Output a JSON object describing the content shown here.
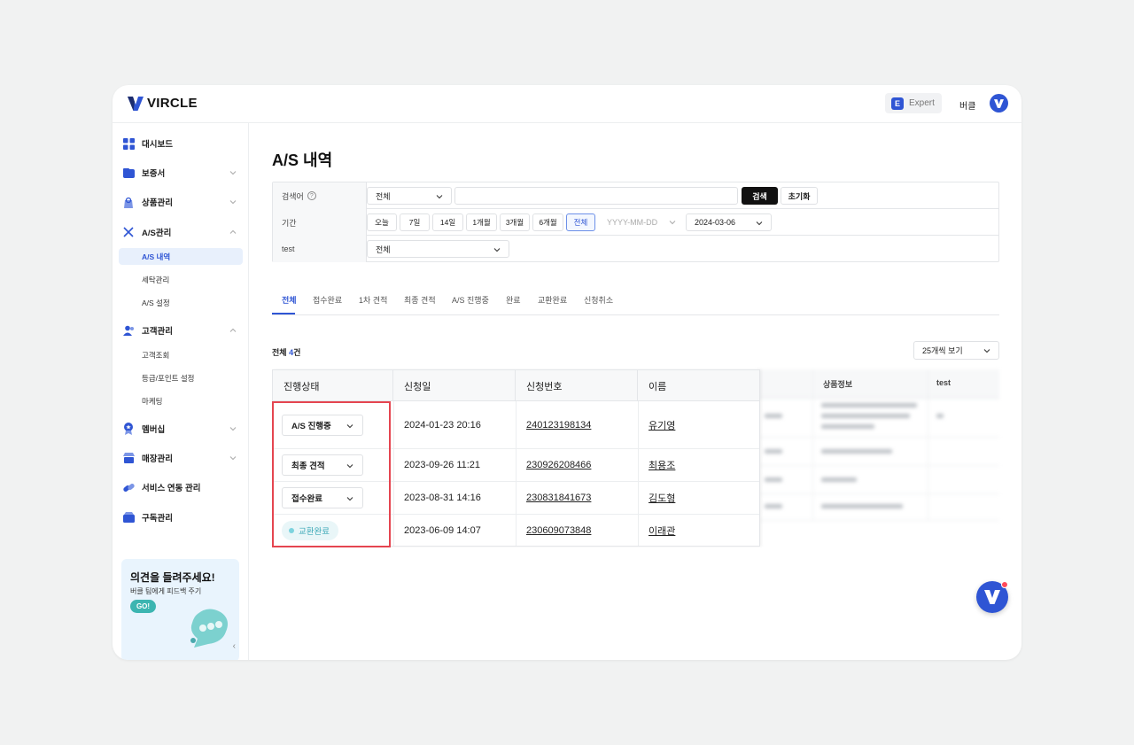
{
  "app": {
    "logo_text": "VIRCLE",
    "plan_letter": "E",
    "plan_label": "Expert",
    "user_name": "버클"
  },
  "sidebar": {
    "items": [
      {
        "label": "대시보드"
      },
      {
        "label": "보증서"
      },
      {
        "label": "상품관리"
      },
      {
        "label": "A/S관리"
      },
      {
        "label": "고객관리"
      },
      {
        "label": "멤버십"
      },
      {
        "label": "매장관리"
      },
      {
        "label": "서비스 연동 관리"
      },
      {
        "label": "구독관리"
      }
    ],
    "as_sub": [
      {
        "label": "A/S 내역"
      },
      {
        "label": "세탁관리"
      },
      {
        "label": "A/S 설정"
      }
    ],
    "customer_sub": [
      {
        "label": "고객조회"
      },
      {
        "label": "등급/포인트 설정"
      },
      {
        "label": "마케팅"
      }
    ],
    "promo": {
      "title": "의견을 들려주세요!",
      "subtitle": "버클 팀에게 피드백 주기",
      "button": "GO!"
    }
  },
  "page": {
    "title": "A/S 내역"
  },
  "filter": {
    "search_label": "검색어",
    "search_select": "전체",
    "search_input": "",
    "search_button": "검색",
    "reset_button": "초기화",
    "period_label": "기간",
    "periods": [
      "오늘",
      "7일",
      "14일",
      "1개월",
      "3개월",
      "6개월",
      "전체"
    ],
    "date_from_placeholder": "YYYY-MM-DD",
    "date_to": "2024-03-06",
    "test_label": "test",
    "test_select": "전체"
  },
  "tabs": [
    "전체",
    "접수완료",
    "1차 견적",
    "최종 견적",
    "A/S 진행중",
    "완료",
    "교환완료",
    "신청취소"
  ],
  "summary": {
    "prefix": "전체",
    "count": "4",
    "suffix": "건",
    "per_page": "25개씩 보기"
  },
  "table": {
    "columns": [
      "진행상태",
      "신청일",
      "신청번호",
      "이름"
    ],
    "hidden_columns": [
      "상품정보",
      "test"
    ],
    "rows": [
      {
        "status": "A/S 진행중",
        "date": "2024-01-23 20:16",
        "number": "240123198134",
        "name": "유기영"
      },
      {
        "status": "최종 견적",
        "date": "2023-09-26 11:21",
        "number": "230926208466",
        "name": "최용조"
      },
      {
        "status": "접수완료",
        "date": "2023-08-31 14:16",
        "number": "230831841673",
        "name": "김도형"
      },
      {
        "status": "교환완료",
        "date": "2023-06-09 14:07",
        "number": "230609073848",
        "name": "이래관"
      }
    ]
  },
  "colors": {
    "accent": "#2f55d4",
    "highlight": "#e54550",
    "badge_teal": "#39a7b6"
  }
}
